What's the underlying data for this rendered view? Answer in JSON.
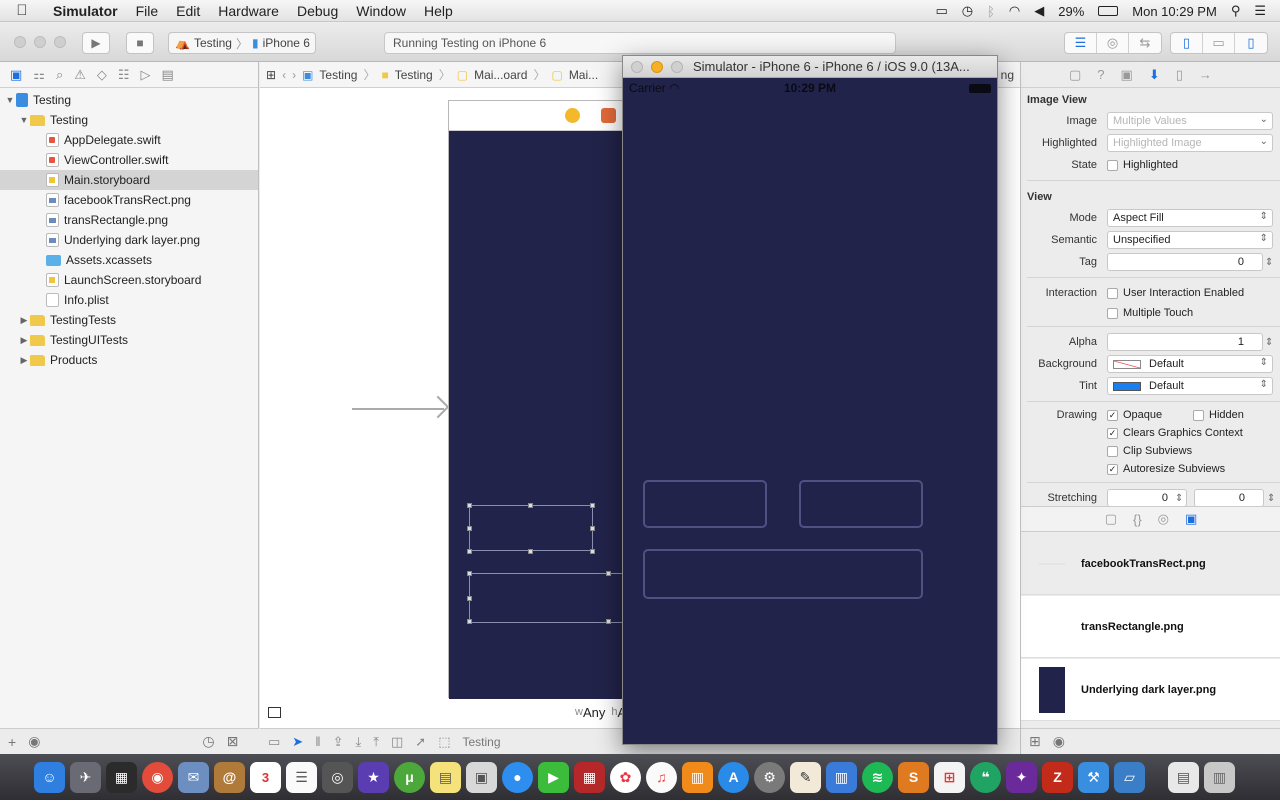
{
  "menubar": {
    "apple": "",
    "app_name": "Simulator",
    "items": [
      "File",
      "Edit",
      "Hardware",
      "Debug",
      "Window",
      "Help"
    ],
    "battery": "29%",
    "clock": "Mon 10:29 PM"
  },
  "toolbar": {
    "scheme_target": "Testing",
    "scheme_device": "iPhone 6",
    "status": "Running Testing on iPhone 6"
  },
  "navigator": {
    "project": "Testing",
    "group": "Testing",
    "files": [
      "AppDelegate.swift",
      "ViewController.swift",
      "Main.storyboard",
      "facebookTransRect.png",
      "transRectangle.png",
      "Underlying dark layer.png",
      "Assets.xcassets",
      "LaunchScreen.storyboard",
      "Info.plist"
    ],
    "selected_file": "Main.storyboard",
    "groups": [
      "TestingTests",
      "TestingUITests",
      "Products"
    ]
  },
  "jumpbar": {
    "crumbs": [
      "Testing",
      "Testing",
      "Mai...oard",
      "Mai..."
    ],
    "trailing": "ng"
  },
  "editor": {
    "size_w_prefix": "w",
    "size_w": "Any",
    "size_h_prefix": "h",
    "size_h": "A",
    "bottom_label": "Testing"
  },
  "simulator": {
    "title": "Simulator - iPhone 6 - iPhone 6 / iOS 9.0 (13A...",
    "carrier": "Carrier",
    "time": "10:29 PM"
  },
  "inspector": {
    "image_view": {
      "section": "Image View",
      "image_label": "Image",
      "image_placeholder": "Multiple Values",
      "highlighted_label": "Highlighted",
      "highlighted_placeholder": "Highlighted Image",
      "state_label": "State",
      "state_option": "Highlighted"
    },
    "view": {
      "section": "View",
      "mode_label": "Mode",
      "mode_value": "Aspect Fill",
      "semantic_label": "Semantic",
      "semantic_value": "Unspecified",
      "tag_label": "Tag",
      "tag_value": "0",
      "interaction_label": "Interaction",
      "user_interaction": "User Interaction Enabled",
      "multiple_touch": "Multiple Touch",
      "alpha_label": "Alpha",
      "alpha_value": "1",
      "background_label": "Background",
      "background_value": "Default",
      "tint_label": "Tint",
      "tint_value": "Default",
      "tint_color": "#1a7ff0",
      "drawing_label": "Drawing",
      "opaque": "Opaque",
      "hidden": "Hidden",
      "clears": "Clears Graphics Context",
      "clip": "Clip Subviews",
      "autoresize": "Autoresize Subviews",
      "stretching_label": "Stretching",
      "stretch_x": "0",
      "stretch_y": "0"
    },
    "library": [
      "facebookTransRect.png",
      "transRectangle.png",
      "Underlying dark layer.png"
    ]
  },
  "colors": {
    "scene_bg": "#22234a",
    "accent": "#1d6ee0"
  },
  "dock": {
    "calendar_day": "3"
  }
}
